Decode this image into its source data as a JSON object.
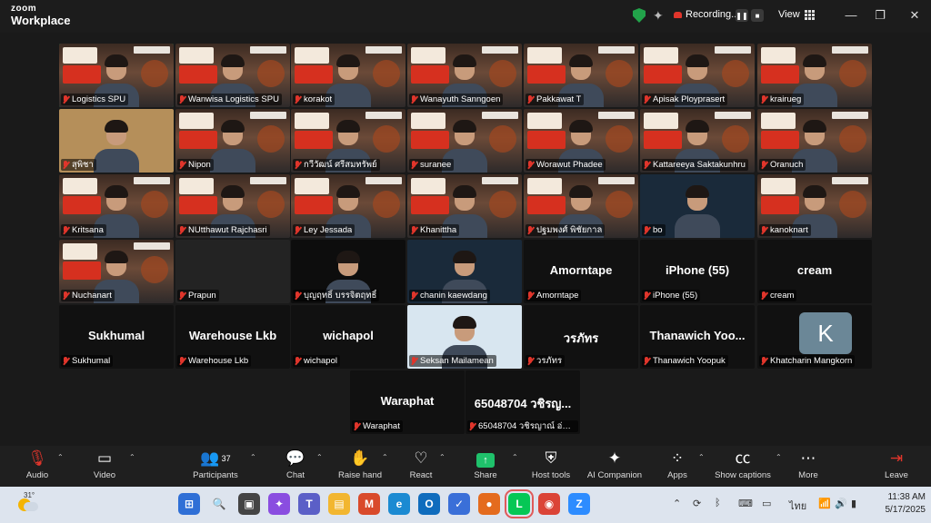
{
  "app": {
    "title_line1": "zoom",
    "title_line2": "Workplace",
    "recording_label": "Recording...",
    "view_label": "View"
  },
  "window_controls": {
    "minimize": "—",
    "restore": "❐",
    "close": "✕"
  },
  "tiles": [
    {
      "name": "Logistics SPU",
      "kind": "banner",
      "active": true
    },
    {
      "name": "Wanwisa Logistics SPU",
      "kind": "banner"
    },
    {
      "name": "korakot",
      "kind": "banner"
    },
    {
      "name": "Wanayuth Sanngoen",
      "kind": "banner"
    },
    {
      "name": "Pakkawat T",
      "kind": "banner"
    },
    {
      "name": "Apisak Ployprasert",
      "kind": "banner"
    },
    {
      "name": "krairueg",
      "kind": "banner"
    },
    {
      "name": "สุพิชา",
      "kind": "cam"
    },
    {
      "name": "Nipon",
      "kind": "banner"
    },
    {
      "name": "กวีวัฒน์ ศรีสมทรัพย์",
      "kind": "banner"
    },
    {
      "name": "suranee",
      "kind": "banner"
    },
    {
      "name": "Worawut Phadee",
      "kind": "banner"
    },
    {
      "name": "Kattareeya Saktakunhru",
      "kind": "banner"
    },
    {
      "name": "Oranuch",
      "kind": "banner"
    },
    {
      "name": "Kritsana",
      "kind": "banner"
    },
    {
      "name": "NUtthawut Rajchasri",
      "kind": "banner"
    },
    {
      "name": "Ley Jessada",
      "kind": "banner"
    },
    {
      "name": "Khanittha",
      "kind": "banner"
    },
    {
      "name": "ปฐมพงศ์ พิชัยกาล",
      "kind": "banner"
    },
    {
      "name": "bo",
      "kind": "cam"
    },
    {
      "name": "kanoknart",
      "kind": "banner"
    },
    {
      "name": "Nuchanart",
      "kind": "banner"
    },
    {
      "name": "Prapun",
      "kind": "empty"
    },
    {
      "name": "บุญฤทธิ์ บรรจิตฤทธิ์",
      "kind": "cam"
    },
    {
      "name": "chanin kaewdang",
      "kind": "cam"
    },
    {
      "name": "Amorntape",
      "kind": "text",
      "display": "Amorntape"
    },
    {
      "name": "iPhone (55)",
      "kind": "text",
      "display": "iPhone (55)"
    },
    {
      "name": "cream",
      "kind": "text",
      "display": "cream"
    },
    {
      "name": "Sukhumal",
      "kind": "text",
      "display": "Sukhumal"
    },
    {
      "name": "Warehouse Lkb",
      "kind": "text",
      "display": "Warehouse Lkb"
    },
    {
      "name": "wichapol",
      "kind": "text",
      "display": "wichapol"
    },
    {
      "name": "Seksan Mailamean",
      "kind": "cam"
    },
    {
      "name": "วรภัทร",
      "kind": "text",
      "display": "วรภัทร"
    },
    {
      "name": "Thanawich Yoopuk",
      "kind": "text",
      "display": "Thanawich Yoo..."
    },
    {
      "name": "Khatcharin Mangkorn",
      "kind": "avatar",
      "display": "K"
    },
    {
      "name": "Waraphat",
      "kind": "text",
      "display": "Waraphat"
    },
    {
      "name": "65048704 วชิรญาณ์ อ่อน...",
      "kind": "text",
      "display": "65048704 วชิรญ..."
    }
  ],
  "toolbar": {
    "audio": "Audio",
    "video": "Video",
    "participants": "Participants",
    "participants_count": "37",
    "chat": "Chat",
    "raise_hand": "Raise hand",
    "react": "React",
    "share": "Share",
    "host_tools": "Host tools",
    "ai_companion": "AI Companion",
    "apps": "Apps",
    "show_captions": "Show captions",
    "more": "More",
    "leave": "Leave"
  },
  "taskbar": {
    "weather_temp": "31°",
    "lang": "ไทย",
    "time": "11:38 AM",
    "date": "5/17/2025",
    "apps": [
      {
        "name": "start",
        "color": "#2f6fd6",
        "glyph": "⊞"
      },
      {
        "name": "search",
        "color": "#dde4ee",
        "glyph": "🔍"
      },
      {
        "name": "task-view",
        "color": "#444",
        "glyph": "▣"
      },
      {
        "name": "copilot",
        "color": "#8a4de0",
        "glyph": "✦"
      },
      {
        "name": "teams",
        "color": "#5b5fc7",
        "glyph": "T"
      },
      {
        "name": "file-explorer",
        "color": "#f2b630",
        "glyph": "▤"
      },
      {
        "name": "m365",
        "color": "#d94a2b",
        "glyph": "M"
      },
      {
        "name": "edge",
        "color": "#1b8ad2",
        "glyph": "e"
      },
      {
        "name": "outlook",
        "color": "#0f6cbd",
        "glyph": "O"
      },
      {
        "name": "todo",
        "color": "#3a6fd8",
        "glyph": "✓"
      },
      {
        "name": "firefox",
        "color": "#e46b1e",
        "glyph": "●"
      },
      {
        "name": "line",
        "color": "#06c755",
        "glyph": "L"
      },
      {
        "name": "chrome",
        "color": "#db4437",
        "glyph": "◉"
      },
      {
        "name": "zoom",
        "color": "#2d8cff",
        "glyph": "Z"
      }
    ]
  }
}
